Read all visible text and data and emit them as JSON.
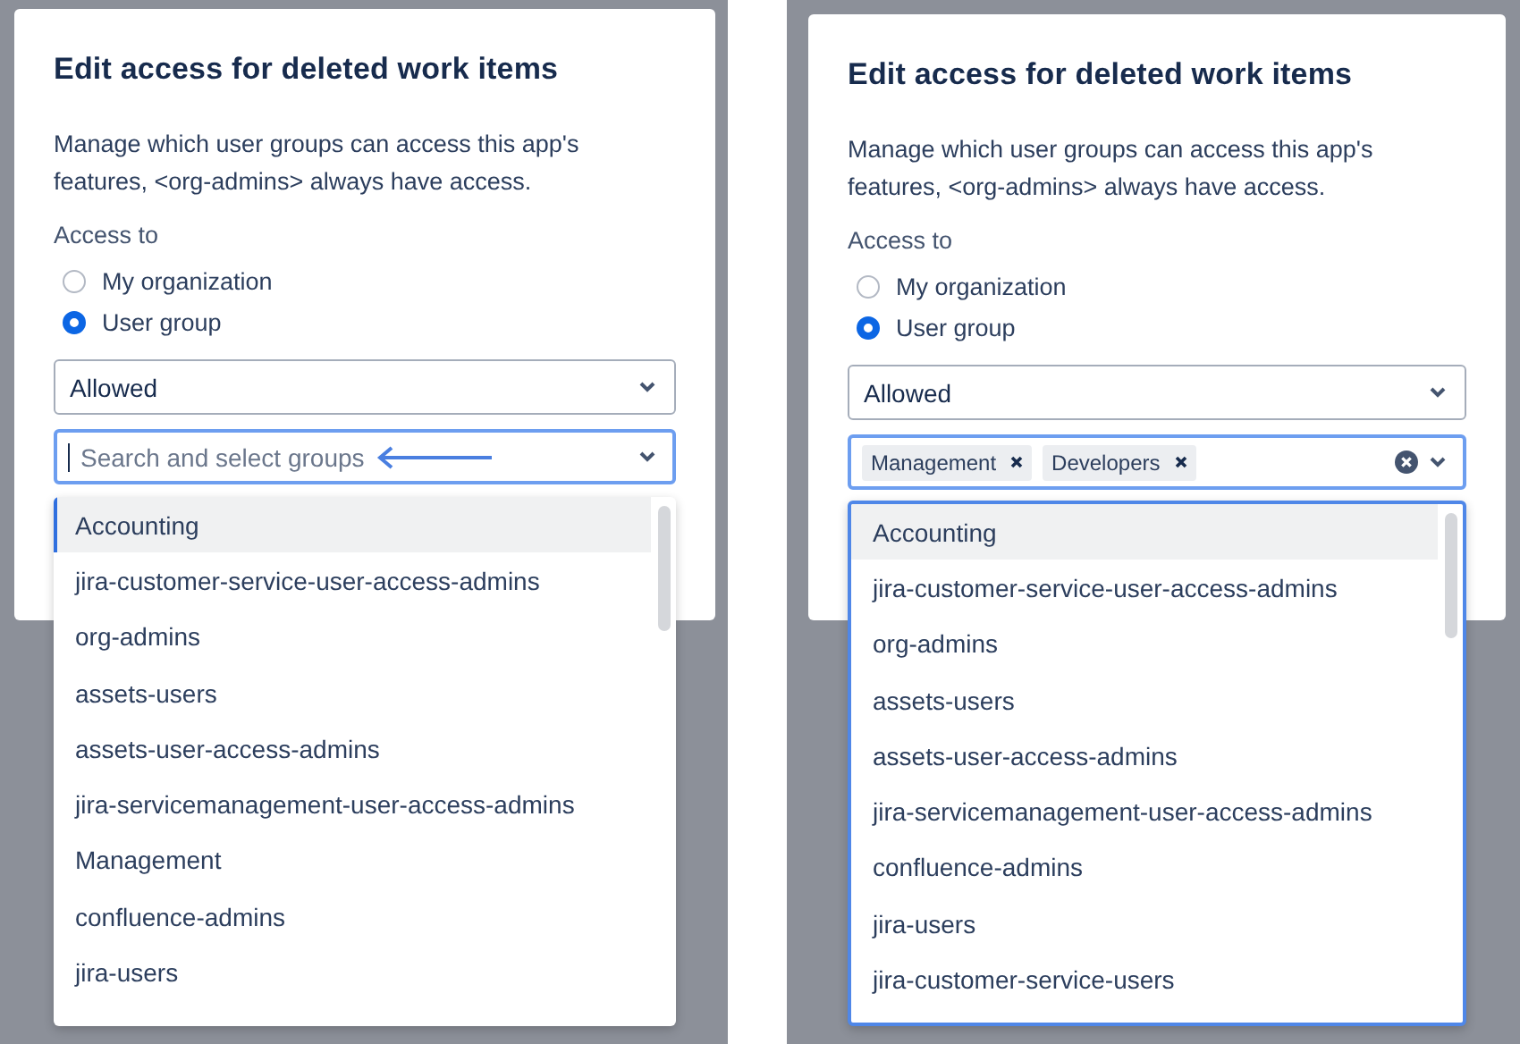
{
  "panels": [
    {
      "dialog": {
        "title": "Edit access for deleted work items",
        "description": "Manage which user groups can access this app's features, <org-admins> always have access.",
        "access_label": "Access to",
        "radios": [
          {
            "label": "My organization",
            "selected": false
          },
          {
            "label": "User group",
            "selected": true
          }
        ],
        "permission_select": {
          "value": "Allowed"
        },
        "group_select": {
          "placeholder": "Search and select groups",
          "focused": true
        },
        "menu": {
          "focused": false,
          "options": [
            {
              "label": "Accounting",
              "selected": true,
              "focused": true
            },
            {
              "label": "jira-customer-service-user-access-admins",
              "selected": false,
              "focused": false
            },
            {
              "label": "org-admins",
              "selected": false,
              "focused": false
            },
            {
              "label": "assets-users",
              "selected": false,
              "focused": false
            },
            {
              "label": "assets-user-access-admins",
              "selected": false,
              "focused": false
            },
            {
              "label": "jira-servicemanagement-user-access-admins",
              "selected": false,
              "focused": false
            },
            {
              "label": "Management",
              "selected": false,
              "focused": false
            },
            {
              "label": "confluence-admins",
              "selected": false,
              "focused": false
            },
            {
              "label": "jira-users",
              "selected": false,
              "focused": false
            }
          ]
        }
      }
    },
    {
      "dialog": {
        "title": "Edit access for deleted work items",
        "description": "Manage which user groups can access this app's features, <org-admins> always have access.",
        "access_label": "Access to",
        "radios": [
          {
            "label": "My organization",
            "selected": false
          },
          {
            "label": "User group",
            "selected": true
          }
        ],
        "permission_select": {
          "value": "Allowed"
        },
        "group_select": {
          "focused": true,
          "tags": [
            "Management",
            "Developers"
          ]
        },
        "menu": {
          "focused": true,
          "options": [
            {
              "label": "Accounting",
              "selected": true,
              "focused": false
            },
            {
              "label": "jira-customer-service-user-access-admins",
              "selected": false,
              "focused": false
            },
            {
              "label": "org-admins",
              "selected": false,
              "focused": false
            },
            {
              "label": "assets-users",
              "selected": false,
              "focused": false
            },
            {
              "label": "assets-user-access-admins",
              "selected": false,
              "focused": false
            },
            {
              "label": "jira-servicemanagement-user-access-admins",
              "selected": false,
              "focused": false
            },
            {
              "label": "confluence-admins",
              "selected": false,
              "focused": false
            },
            {
              "label": "jira-users",
              "selected": false,
              "focused": false
            },
            {
              "label": "jira-customer-service-users",
              "selected": false,
              "focused": false
            }
          ]
        }
      }
    }
  ]
}
